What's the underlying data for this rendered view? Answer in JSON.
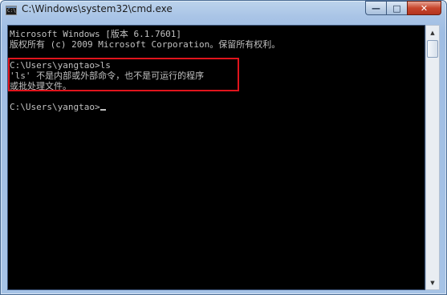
{
  "window": {
    "title": "C:\\Windows\\system32\\cmd.exe",
    "icon_glyph": "C:\\"
  },
  "caption_buttons": {
    "minimize": "—",
    "maximize": "□",
    "close": "✕"
  },
  "console": {
    "lines": [
      "Microsoft Windows [版本 6.1.7601]",
      "版权所有 (c) 2009 Microsoft Corporation。保留所有权利。",
      "",
      "C:\\Users\\yangtao>ls",
      "'ls' 不是内部或外部命令，也不是可运行的程序",
      "或批处理文件。",
      "",
      "C:\\Users\\yangtao>"
    ]
  },
  "scrollbar": {
    "up_arrow": "▲",
    "down_arrow": "▼"
  },
  "colors": {
    "console_bg": "#000000",
    "console_fg": "#c0c0c0",
    "highlight": "#e0141c"
  },
  "icons": [
    "console-app-icon",
    "minimize-icon",
    "maximize-icon",
    "close-icon",
    "scroll-up-icon",
    "scroll-down-icon"
  ]
}
